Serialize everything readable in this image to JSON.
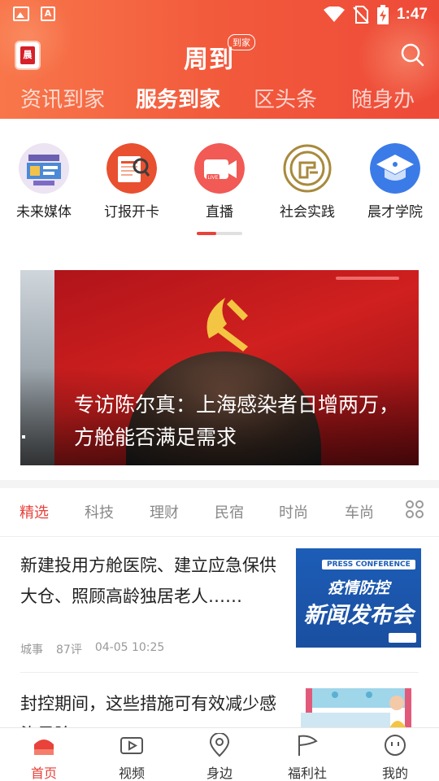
{
  "status_bar": {
    "time": "1:47",
    "left_icons": [
      "image-icon",
      "text-app-icon"
    ],
    "right_icons": [
      "wifi-icon",
      "no-sim-icon",
      "battery-charging-icon"
    ]
  },
  "header": {
    "brand": "周到",
    "brand_badge": "到家",
    "app_logo_text": "晨",
    "channel_tabs": [
      {
        "label": "资讯到家",
        "active": false
      },
      {
        "label": "服务到家",
        "active": true
      },
      {
        "label": "区头条",
        "active": false
      },
      {
        "label": "随身办",
        "active": false
      }
    ],
    "accent_color": "#f25a3c"
  },
  "services": [
    {
      "label": "未来媒体",
      "icon": "future-media-icon"
    },
    {
      "label": "订报开卡",
      "icon": "newspaper-subscribe-icon"
    },
    {
      "label": "直播",
      "icon": "live-icon"
    },
    {
      "label": "社会实践",
      "icon": "social-practice-icon"
    },
    {
      "label": "晨才学院",
      "icon": "academy-icon"
    }
  ],
  "banner": {
    "title": "专访陈尔真：上海感染者日增两万，方舱能否满足需求"
  },
  "category_tabs": [
    {
      "label": "精选",
      "active": true
    },
    {
      "label": "科技",
      "active": false
    },
    {
      "label": "理财",
      "active": false
    },
    {
      "label": "民宿",
      "active": false
    },
    {
      "label": "时尚",
      "active": false
    },
    {
      "label": "车尚",
      "active": false
    }
  ],
  "news": [
    {
      "title": "新建投用方舱医院、建立应急保供大仓、照顾高龄独居老人……",
      "source": "城事",
      "comments": "87评",
      "time": "04-05 10:25",
      "thumb": {
        "tag": "PRESS CONFERENCE",
        "line1": "疫情防控",
        "line2": "新闻发布会"
      }
    },
    {
      "title": "封控期间，这些措施可有效减少感染风险"
    }
  ],
  "bottom_nav": [
    {
      "label": "首页",
      "icon": "home-icon",
      "active": true
    },
    {
      "label": "视频",
      "icon": "video-icon",
      "active": false
    },
    {
      "label": "身边",
      "icon": "location-pin-icon",
      "active": false
    },
    {
      "label": "福利社",
      "icon": "flag-icon",
      "active": false
    },
    {
      "label": "我的",
      "icon": "profile-smile-icon",
      "active": false
    }
  ]
}
